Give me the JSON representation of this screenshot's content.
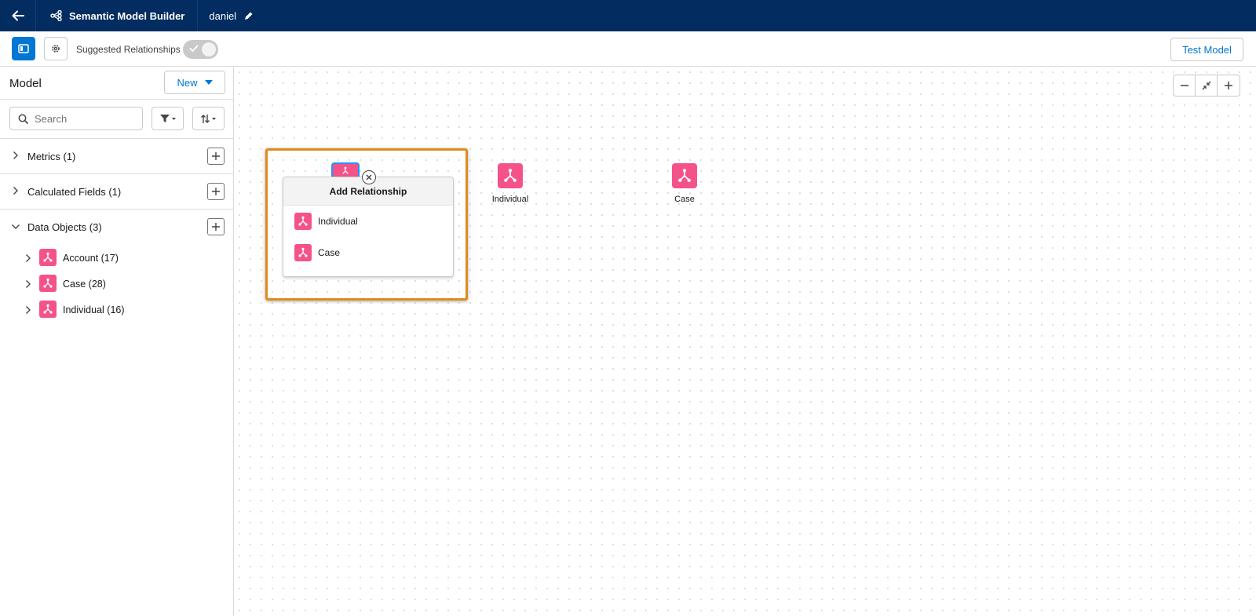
{
  "header": {
    "app_title": "Semantic Model Builder",
    "model_name": "daniel"
  },
  "toolbar": {
    "suggested_relationships_label": "Suggested Relationships",
    "suggested_relationships_on": true,
    "test_model_label": "Test Model"
  },
  "sidebar": {
    "title": "Model",
    "new_label": "New",
    "search_placeholder": "Search",
    "sections": [
      {
        "label": "Metrics (1)",
        "expanded": false
      },
      {
        "label": "Calculated Fields (1)",
        "expanded": false
      },
      {
        "label": "Data Objects (3)",
        "expanded": true
      }
    ],
    "data_objects": [
      {
        "label": "Account (17)"
      },
      {
        "label": "Case (28)"
      },
      {
        "label": "Individual (16)"
      }
    ]
  },
  "canvas": {
    "nodes": [
      {
        "label": "Individual"
      },
      {
        "label": "Case"
      }
    ],
    "popover": {
      "title": "Add Relationship",
      "items": [
        {
          "label": "Individual"
        },
        {
          "label": "Case"
        }
      ]
    }
  },
  "colors": {
    "header_bg": "#032d60",
    "brand_blue": "#0176d3",
    "object_icon": "#f5528a",
    "highlight": "#e08b1d"
  }
}
